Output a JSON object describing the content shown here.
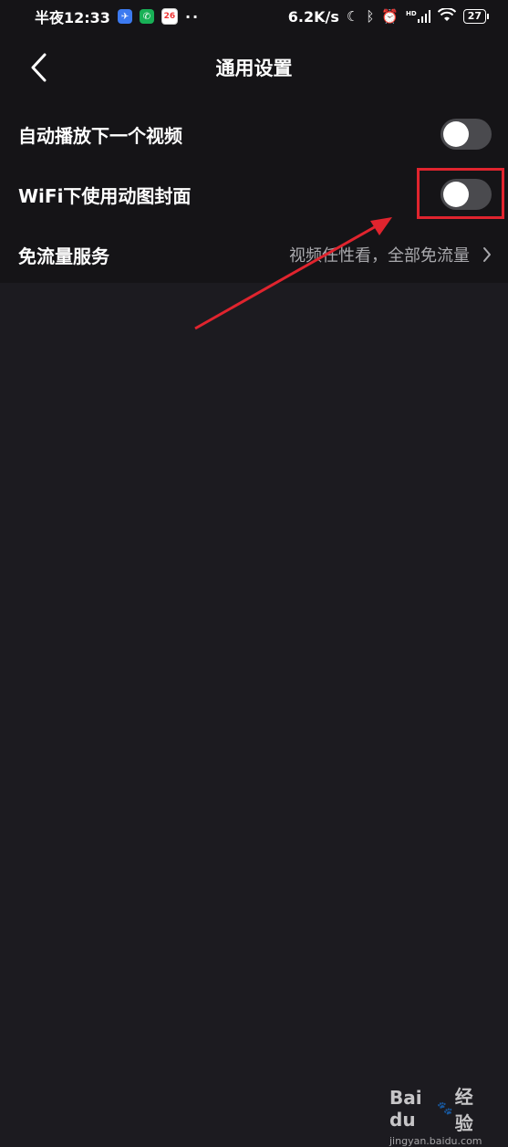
{
  "status_bar": {
    "time": "半夜12:33",
    "calendar_day": "26",
    "more_dots": "··",
    "network_speed": "6.2K/s",
    "signal_tag": "HD",
    "battery": "27"
  },
  "header": {
    "title": "通用设置"
  },
  "settings": [
    {
      "label": "自动播放下一个视频",
      "control": "toggle",
      "on": false
    },
    {
      "label": "WiFi下使用动图封面",
      "control": "toggle",
      "on": false
    },
    {
      "label": "免流量服务",
      "control": "link",
      "value": "视频任性看，全部免流量"
    }
  ],
  "watermark": {
    "brand": "Bai du",
    "suffix": "经验",
    "url": "jingyan.baidu.com"
  },
  "colors": {
    "background": "#1c1b20",
    "surface": "#151417",
    "toggle_off": "#4a4a4e",
    "annotation_red": "#e0242e"
  }
}
